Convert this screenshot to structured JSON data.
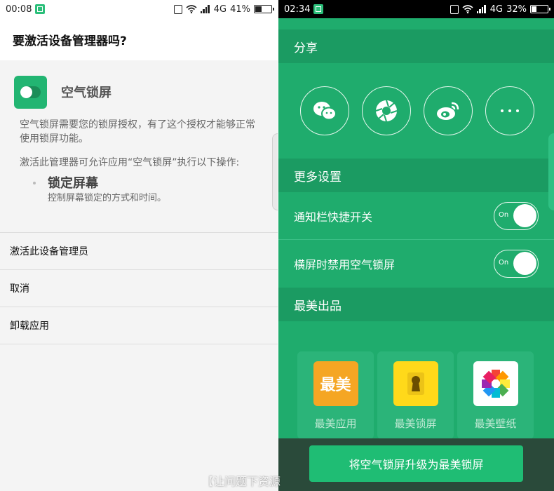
{
  "left": {
    "status": {
      "time": "00:08",
      "network": "4G",
      "battery": "41%",
      "battery_level": 0.41
    },
    "dialog_title": "要激活设备管理器吗?",
    "app_name": "空气锁屏",
    "description": "空气锁屏需要您的锁屏授权，有了这个授权才能够正常使用锁屏功能。",
    "activation_note": "激活此管理器可允许应用“空气锁屏”执行以下操作:",
    "permission": {
      "title": "锁定屏幕",
      "desc": "控制屏幕锁定的方式和时间。"
    },
    "menu": [
      "激活此设备管理员",
      "取消",
      "卸载应用"
    ]
  },
  "right": {
    "status": {
      "time": "02:34",
      "network": "4G",
      "battery": "32%",
      "battery_level": 0.32
    },
    "share_title": "分享",
    "share_icons": [
      "wechat-icon",
      "moments-icon",
      "weibo-icon",
      "more-icon"
    ],
    "more_settings_title": "更多设置",
    "settings": [
      {
        "label": "通知栏快捷开关",
        "toggle": "On"
      },
      {
        "label": "横屏时禁用空气锁屏",
        "toggle": "On"
      }
    ],
    "products_title": "最美出品",
    "apps": [
      {
        "label": "最美应用",
        "icon_text": "最美",
        "color": "#f5a623"
      },
      {
        "label": "最美锁屏",
        "color": "#ffd91a"
      },
      {
        "label": "最美壁纸",
        "color": "#ffffff"
      }
    ],
    "upgrade_button": "将空气锁屏升级为最美锁屏"
  },
  "watermark": "【让问题下资源"
}
